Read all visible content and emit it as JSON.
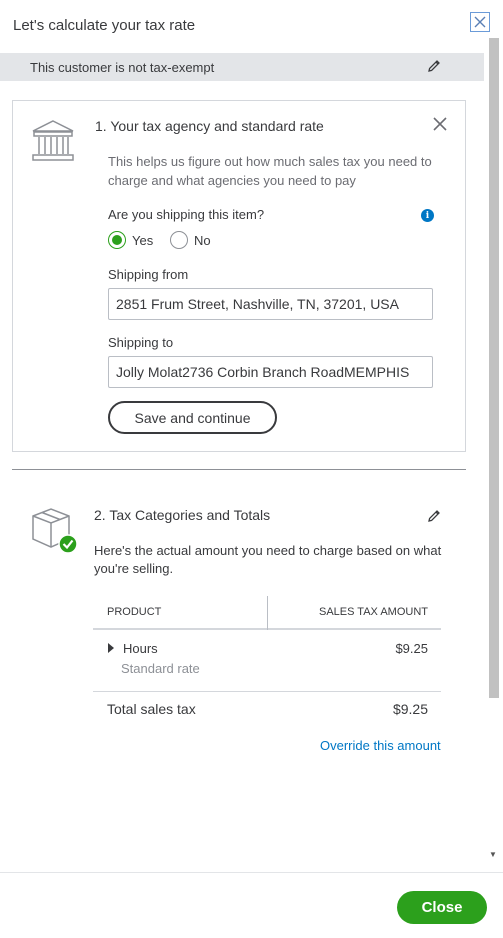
{
  "panel": {
    "title": "Let's calculate your tax rate"
  },
  "exempt": {
    "text": "This customer is not tax-exempt"
  },
  "section1": {
    "title": "1. Your tax agency and standard rate",
    "description_line1": "This helps us figure out how much sales tax you need to",
    "description_line2": "charge and what agencies you need to pay",
    "shipping_question": "Are you shipping this item?",
    "radio_yes": "Yes",
    "radio_no": "No",
    "selected": "Yes",
    "shipping_from_label": "Shipping from",
    "shipping_from_value": "2851  Frum Street, Nashville, TN, 37201, USA",
    "shipping_to_label": "Shipping to",
    "shipping_to_value": "Jolly Molat2736  Corbin Branch RoadMEMPHIS",
    "save_button": "Save and continue"
  },
  "section2": {
    "title": "2. Tax Categories and Totals",
    "description_line1": "Here's the actual amount you need to charge based on what",
    "description_line2": "you're selling.",
    "table": {
      "col_product": "PRODUCT",
      "col_amount": "SALES TAX AMOUNT",
      "rows": [
        {
          "name": "Hours",
          "sub": "Standard rate",
          "amount": "$9.25"
        }
      ],
      "total_label": "Total sales tax",
      "total_amount": "$9.25"
    },
    "override_link": "Override this amount"
  },
  "footer": {
    "close_button": "Close"
  },
  "colors": {
    "accent": "#2ca01c",
    "link": "#0077c5",
    "banner": "#e3e5e8"
  }
}
